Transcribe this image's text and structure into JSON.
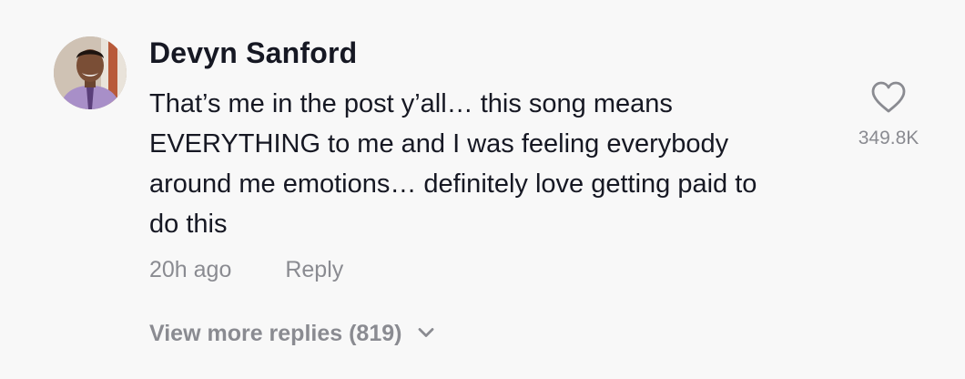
{
  "comment": {
    "username": "Devyn Sanford",
    "text_lines": [
      "That’s me in the post y’all… this song means",
      "EVERYTHING to me and I was feeling everybody",
      "around me emotions… definitely love getting paid to",
      "do this"
    ],
    "timestamp": "20h ago",
    "reply_label": "Reply",
    "like_count": "349.8K",
    "view_more_label": "View more replies (819)"
  },
  "icons": {
    "like": "heart-icon",
    "expand": "chevron-down-icon"
  },
  "colors": {
    "background": "#f8f8f8",
    "primary_text": "#161823",
    "secondary_text": "#8a8b91"
  }
}
